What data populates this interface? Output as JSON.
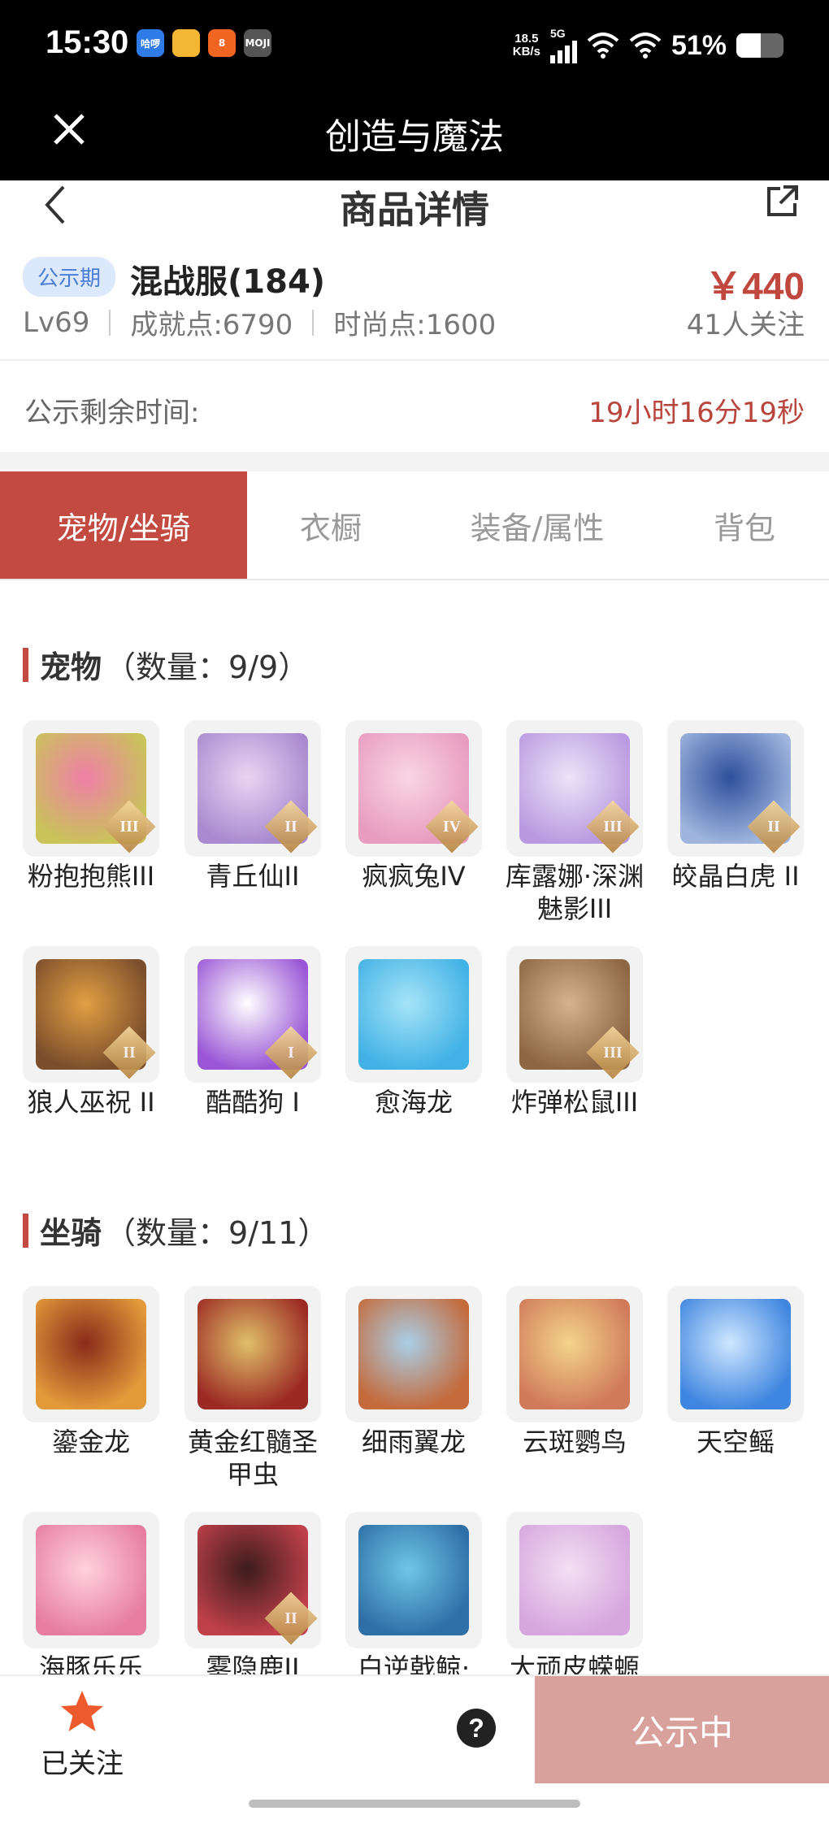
{
  "status_bar": {
    "time": "15:30",
    "apps": [
      {
        "label": "哈啰",
        "icon": "haluo-app-icon",
        "color": "#2f7be8"
      },
      {
        "label": "",
        "icon": "yellow-app-icon",
        "color": "#f3b733"
      },
      {
        "label": "8",
        "icon": "orange-app-icon",
        "color": "#f06522"
      },
      {
        "label": "MOJI",
        "icon": "moji-weather-icon",
        "color": "#555555"
      }
    ],
    "net_speed_top": "18.5",
    "net_speed_bottom": "KB/s",
    "signal": "5G",
    "battery": "51%",
    "battery_level": 0.51
  },
  "app_bar": {
    "title": "创造与魔法"
  },
  "nav": {
    "title": "商品详情"
  },
  "product": {
    "badge": "公示期",
    "name": "混战服(184)",
    "price": "￥440",
    "level": "Lv69",
    "achievement": "成就点:6790",
    "fashion": "时尚点:1600",
    "followers": "41人关注"
  },
  "timer": {
    "label": "公示剩余时间:",
    "value": "19小时16分19秒"
  },
  "tabs": [
    "宠物/坐骑",
    "衣橱",
    "装备/属性",
    "背包"
  ],
  "pets": {
    "title": "宠物",
    "count": "（数量：9/9）",
    "items": [
      {
        "name": "粉抱抱熊III",
        "rank": "III",
        "c1": "#f07fa8",
        "c2": "#c9c35a"
      },
      {
        "name": "青丘仙II",
        "rank": "II",
        "c1": "#e9d5f2",
        "c2": "#a98ad0"
      },
      {
        "name": "疯疯兔IV",
        "rank": "IV",
        "c1": "#f9d6e3",
        "c2": "#e89cc0"
      },
      {
        "name": "库露娜·深渊魅影III",
        "rank": "III",
        "c1": "#ece4f8",
        "c2": "#b99ae0"
      },
      {
        "name": "皎晶白虎 II",
        "rank": "II",
        "c1": "#2e4f9c",
        "c2": "#9fb5de"
      },
      {
        "name": "狼人巫祝 II",
        "rank": "II",
        "c1": "#e2a043",
        "c2": "#7b4d2b"
      },
      {
        "name": "酷酷狗 I",
        "rank": "I",
        "c1": "#ffffff",
        "c2": "#9a56d6"
      },
      {
        "name": "愈海龙",
        "rank": "",
        "c1": "#a6e4f7",
        "c2": "#42b2e6"
      },
      {
        "name": "炸弹松鼠III",
        "rank": "III",
        "c1": "#d6b38e",
        "c2": "#8d6744"
      }
    ]
  },
  "mounts": {
    "title": "坐骑",
    "count": "（数量：9/11）",
    "items": [
      {
        "name": "鎏金龙",
        "rank": "",
        "c1": "#8a2a1a",
        "c2": "#e39b3a"
      },
      {
        "name": "黄金红髓圣甲虫",
        "rank": "",
        "c1": "#e0c068",
        "c2": "#9c2a24"
      },
      {
        "name": "细雨翼龙",
        "rank": "",
        "c1": "#a9cfe8",
        "c2": "#c46a3b"
      },
      {
        "name": "云斑鹦鸟",
        "rank": "",
        "c1": "#f3d58a",
        "c2": "#d07a5a"
      },
      {
        "name": "天空鳐",
        "rank": "",
        "c1": "#cfe7ff",
        "c2": "#3f86e0"
      },
      {
        "name": "海豚乐乐",
        "rank": "",
        "c1": "#ffd1df",
        "c2": "#e77ea2"
      },
      {
        "name": "雾隐鹿II",
        "rank": "II",
        "c1": "#3c1c1c",
        "c2": "#c0404a"
      },
      {
        "name": "白逆戟鲸·",
        "rank": "",
        "c1": "#6fc6e8",
        "c2": "#2e6fa6"
      },
      {
        "name": "大顽皮蝾螈",
        "rank": "",
        "c1": "#f3e0f3",
        "c2": "#d6a6de"
      }
    ]
  },
  "bottom": {
    "follow_label": "已关注",
    "help": "?",
    "cta": "公示中"
  }
}
